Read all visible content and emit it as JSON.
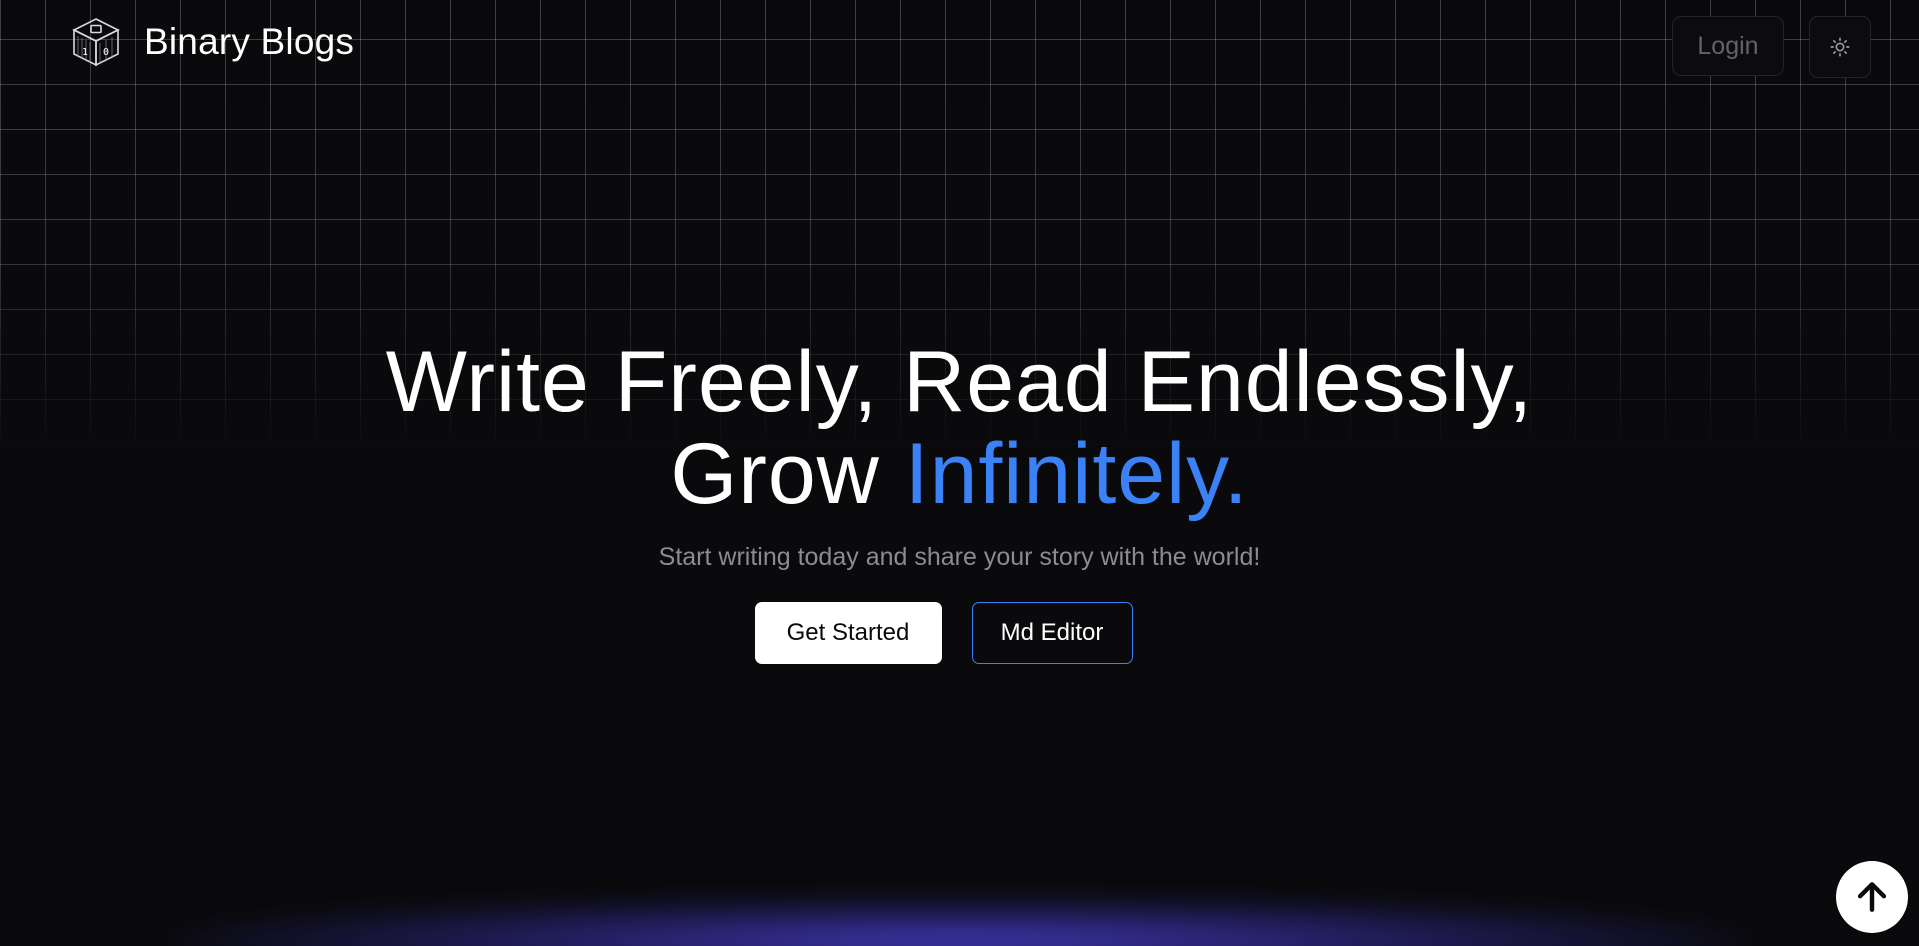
{
  "header": {
    "brand_name": "Binary Blogs",
    "logo_icon": "binary-cube-icon",
    "login_label": "Login",
    "theme_toggle_icon": "sun-icon"
  },
  "hero": {
    "title_line1": "Write Freely, Read Endlessly,",
    "title_line2_prefix": "Grow ",
    "title_line2_accent": "Infinitely.",
    "subtitle": "Start writing today and share your story with the world!",
    "accent_color": "#3b82f6"
  },
  "actions": {
    "get_started_label": "Get Started",
    "md_editor_label": "Md Editor"
  },
  "floating": {
    "scroll_top_icon": "arrow-up-icon"
  },
  "colors": {
    "background": "#0a0a0d",
    "accent": "#3b82f6",
    "glow": "#4f46e5"
  }
}
